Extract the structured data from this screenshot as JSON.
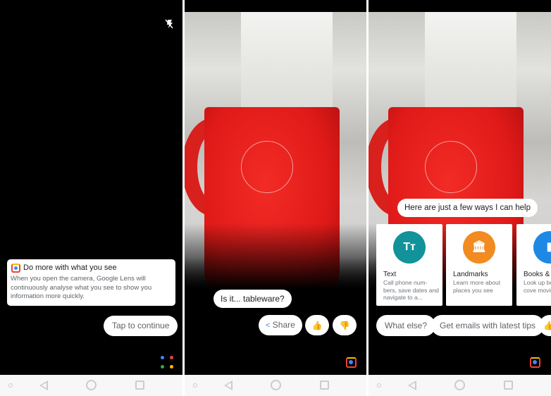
{
  "panel1": {
    "flash_icon": "flash-off-icon",
    "card_title": "Do more with what you see",
    "card_body": "When you open the camera, Google Lens will continuously analyse what you see to show you information more quickly.",
    "continue_label": "Tap to continue",
    "assistant_dots": [
      "#4285f4",
      "#ea4335",
      "#34a853",
      "#fbbc05"
    ]
  },
  "panel2": {
    "guess": "Is it... tableware?",
    "share_label": "Share",
    "thumbs_up_icon": "thumbs-up-icon",
    "thumbs_down_icon": "thumbs-down-icon"
  },
  "panel3": {
    "prompt": "Here are just a few ways I can help",
    "cards": [
      {
        "title": "Text",
        "desc": "Call phone num-bers, save dates and navigate to a...",
        "color": "#12939a",
        "icon": "Tт"
      },
      {
        "title": "Landmarks",
        "desc": "Learn more about places you see",
        "color": "#f28b20",
        "icon": "🏛"
      },
      {
        "title": "Books & M",
        "desc": "Look up bo music cove movies and",
        "color": "#1e88e5",
        "icon": "▮"
      }
    ],
    "chips": [
      "What else?",
      "Get emails with latest tips"
    ]
  },
  "colors": {
    "accent_yellow": "#f9ab00",
    "share_blue": "#4285f4"
  }
}
